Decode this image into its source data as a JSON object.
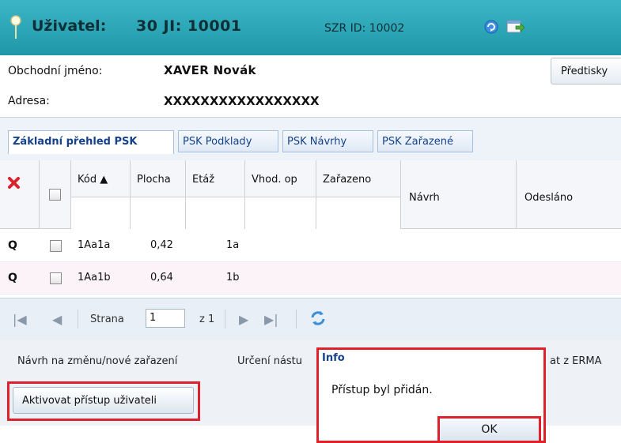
{
  "header": {
    "user_label": "Uživatel:",
    "user_id": "30  JI: 10001",
    "szr_id": "SZR ID: 10002",
    "refresh_icon": "refresh-icon",
    "export_icon": "export-icon",
    "pin_icon": "pin-icon"
  },
  "info": {
    "business_name_label": "Obchodní jméno:",
    "business_name_value": "XAVER  Novák",
    "address_label": "Adresa:",
    "address_value": "XXXXXXXXXXXXXXXXX",
    "templates_button": "Předtisky"
  },
  "tabs": [
    {
      "label": "Základní přehled PSK",
      "active": true
    },
    {
      "label": "PSK Podklady",
      "active": false
    },
    {
      "label": "PSK Návrhy",
      "active": false
    },
    {
      "label": "PSK Zařazené",
      "active": false
    }
  ],
  "grid": {
    "columns": {
      "code": "Kód ▲",
      "area": "Plocha",
      "floor": "Etáž",
      "suitable": "Vhod. op",
      "classified": "Zařazeno",
      "proposal": "Návrh",
      "sent": "Odesláno"
    },
    "rows": [
      {
        "code": "1Aa1a",
        "area": "0,42",
        "floor": "1a"
      },
      {
        "code": "1Aa1b",
        "area": "0,64",
        "floor": "1b"
      }
    ]
  },
  "pager": {
    "page_label": "Strana",
    "page_value": "1",
    "of_label": "z 1"
  },
  "menu": {
    "item1": "Návrh na změnu/nové zařazení",
    "item2": "Určení nástu",
    "item3": "at z ERMA"
  },
  "action": {
    "activate_button": "Aktivovat přístup uživateli"
  },
  "dialog": {
    "title": "Info",
    "message": "Přístup byl přidán.",
    "ok": "OK"
  },
  "colors": {
    "header_bg": "#2aa9ba",
    "highlight": "#e0202a",
    "tab_text": "#15428b"
  }
}
